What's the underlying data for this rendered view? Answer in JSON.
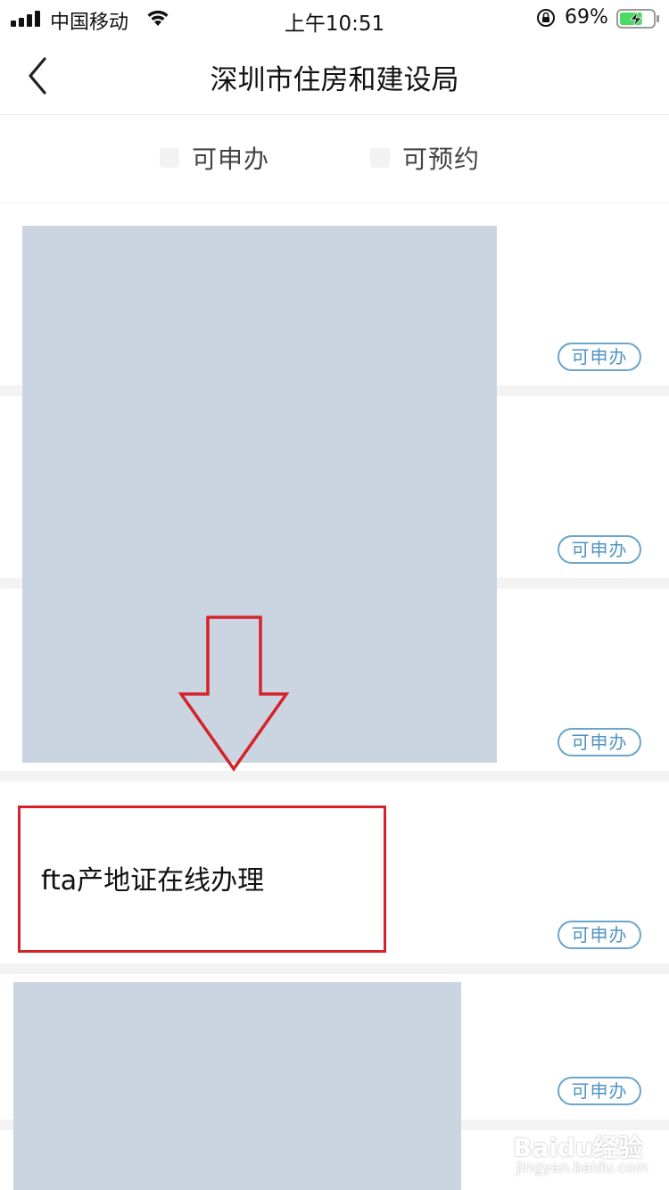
{
  "status_bar": {
    "carrier": "中国移动",
    "time": "上午10:51",
    "battery_percent": "69%",
    "battery_level": 0.69,
    "charging": true
  },
  "nav": {
    "title": "深圳市住房和建设局",
    "back_icon": "chevron-left-icon"
  },
  "filters": [
    {
      "label": "可申办",
      "checked": false
    },
    {
      "label": "可预约",
      "checked": false
    }
  ],
  "list": [
    {
      "title": "",
      "badge": "可申办"
    },
    {
      "title": "",
      "badge": "可申办"
    },
    {
      "title": "",
      "badge": "可申办"
    },
    {
      "title": "fta产地证在线办理",
      "badge": "可申办"
    },
    {
      "title": "",
      "badge": "可申办"
    }
  ],
  "colors": {
    "badge_border": "#6aa6cc",
    "badge_text": "#4f93c2",
    "annotation": "#d5232a",
    "placeholder": "#cbd4e1"
  },
  "watermark": {
    "brand": "Baidu经验",
    "url": "jingyan.baidu.com"
  }
}
